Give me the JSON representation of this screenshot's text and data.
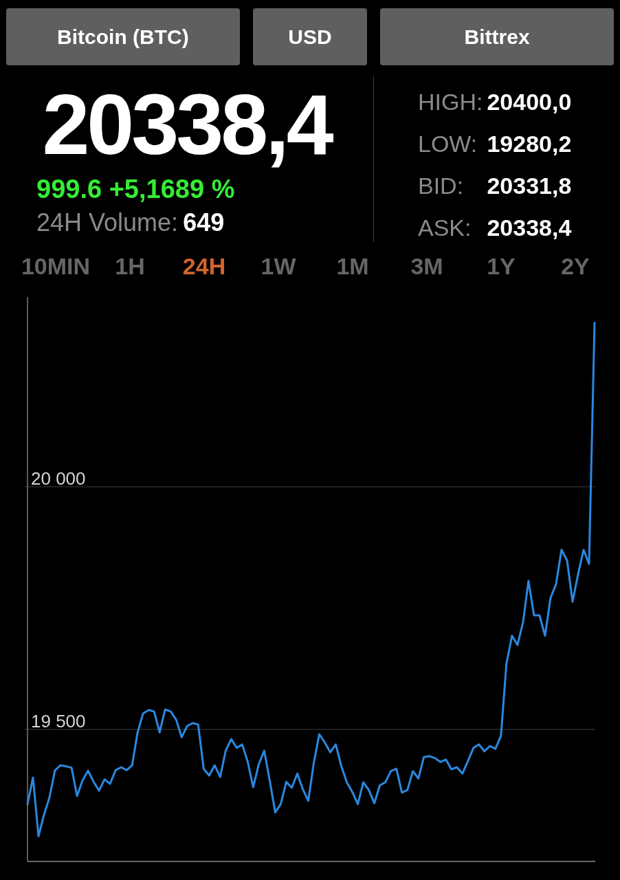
{
  "selectors": [
    {
      "label": "Bitcoin (BTC)"
    },
    {
      "label": "USD"
    },
    {
      "label": "Bittrex"
    }
  ],
  "price": {
    "value": "20338,4",
    "change": "999.6 +5,1689 %",
    "volume_label": "24H Volume:",
    "volume": "649"
  },
  "stats": [
    {
      "label": "HIGH:",
      "value": "20400,0"
    },
    {
      "label": "LOW:",
      "value": "19280,2"
    },
    {
      "label": "BID:",
      "value": "20331,8"
    },
    {
      "label": "ASK:",
      "value": "20338,4"
    }
  ],
  "ranges": [
    {
      "label": "10MIN",
      "selected": false
    },
    {
      "label": "1H",
      "selected": false
    },
    {
      "label": "24H",
      "selected": true
    },
    {
      "label": "1W",
      "selected": false
    },
    {
      "label": "1M",
      "selected": false
    },
    {
      "label": "3M",
      "selected": false
    },
    {
      "label": "1Y",
      "selected": false
    },
    {
      "label": "2Y",
      "selected": false
    }
  ],
  "chart": {
    "chart_data": {
      "type": "line",
      "ylim": [
        19228,
        20391
      ],
      "yticks": [
        {
          "value": 19500,
          "label": "19 500"
        },
        {
          "value": 20000,
          "label": "20 000"
        }
      ],
      "values": [
        19346,
        19401,
        19280,
        19324,
        19360,
        19416,
        19426,
        19424,
        19421,
        19363,
        19395,
        19415,
        19392,
        19374,
        19397,
        19388,
        19416,
        19422,
        19416,
        19426,
        19494,
        19533,
        19540,
        19537,
        19494,
        19541,
        19537,
        19520,
        19484,
        19507,
        19513,
        19510,
        19419,
        19405,
        19426,
        19402,
        19456,
        19480,
        19462,
        19469,
        19433,
        19381,
        19428,
        19456,
        19395,
        19329,
        19346,
        19392,
        19380,
        19409,
        19377,
        19353,
        19431,
        19490,
        19473,
        19453,
        19469,
        19424,
        19391,
        19371,
        19346,
        19391,
        19375,
        19348,
        19385,
        19391,
        19414,
        19419,
        19370,
        19375,
        19414,
        19399,
        19443,
        19445,
        19441,
        19433,
        19438,
        19418,
        19422,
        19409,
        19435,
        19462,
        19469,
        19455,
        19466,
        19460,
        19487,
        19636,
        19693,
        19674,
        19721,
        19806,
        19735,
        19735,
        19693,
        19771,
        19799,
        19870,
        19848,
        19763,
        19820,
        19870,
        19841,
        20338
      ]
    }
  }
}
